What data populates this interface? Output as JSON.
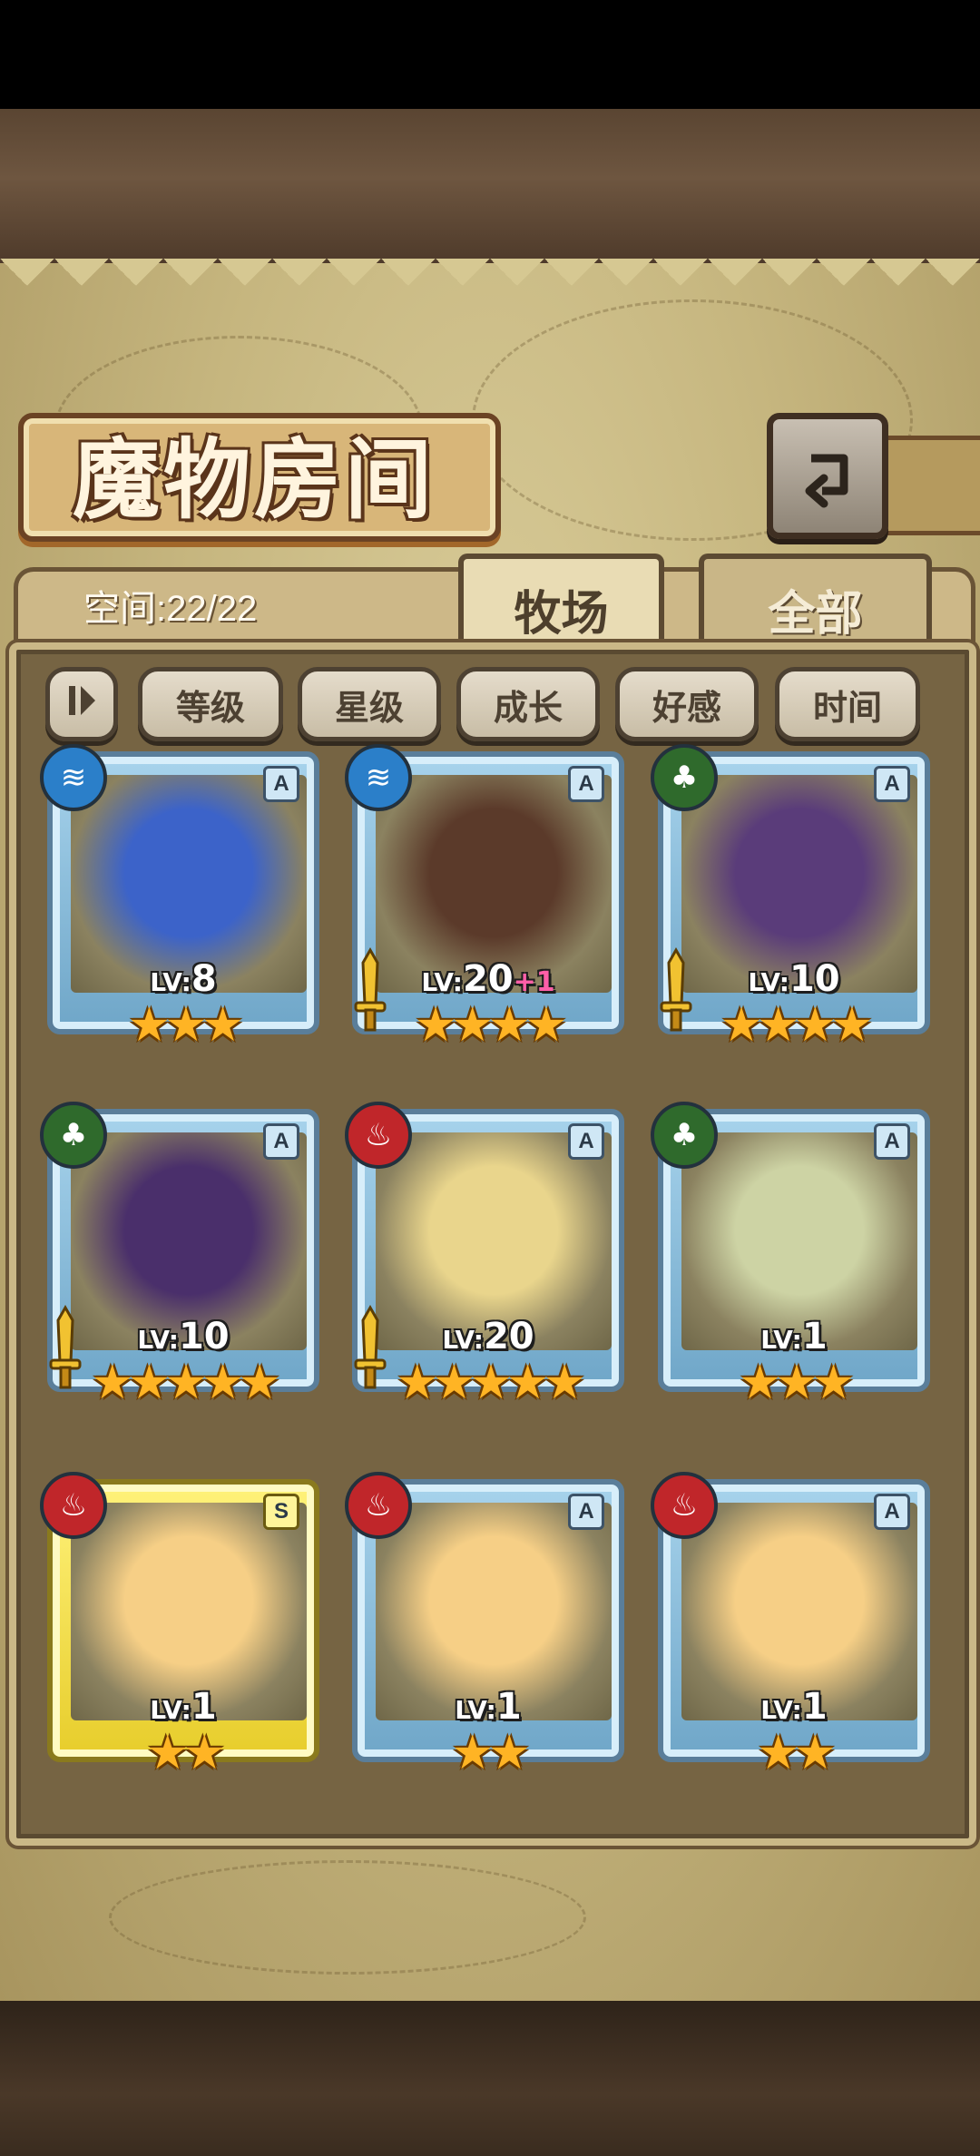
{
  "header": {
    "title": "魔物房间",
    "back_icon": "return-arrow-icon"
  },
  "storage": {
    "space_text": "空间:22/22"
  },
  "tabs": [
    {
      "label": "牧场",
      "active": true
    },
    {
      "label": "全部",
      "active": false
    }
  ],
  "sort": {
    "toggle_icon": "sort-order-icon",
    "buttons": [
      "等级",
      "星级",
      "成长",
      "好感",
      "时间"
    ]
  },
  "monsters": [
    {
      "element": "water",
      "rank": "A",
      "level": "8",
      "stars": "★★★",
      "weapon": false,
      "bonus": "",
      "color": "#3c63c9"
    },
    {
      "element": "water",
      "rank": "A",
      "level": "20",
      "stars": "★★★★",
      "weapon": true,
      "bonus": "+1",
      "color": "#5b3a2a"
    },
    {
      "element": "wood",
      "rank": "A",
      "level": "10",
      "stars": "★★★★",
      "weapon": true,
      "bonus": "",
      "color": "#5a3c7a"
    },
    {
      "element": "wood",
      "rank": "A",
      "level": "10",
      "stars": "★★★★★",
      "weapon": true,
      "bonus": "",
      "color": "#4a2f6b"
    },
    {
      "element": "fire",
      "rank": "A",
      "level": "20",
      "stars": "★★★★★",
      "weapon": true,
      "bonus": "",
      "color": "#e9d58c"
    },
    {
      "element": "wood",
      "rank": "A",
      "level": "1",
      "stars": "★★★",
      "weapon": false,
      "bonus": "",
      "color": "#cdd3a4"
    },
    {
      "element": "fire",
      "rank": "S",
      "level": "1",
      "stars": "★★",
      "weapon": false,
      "bonus": "",
      "color": "#f6cf86"
    },
    {
      "element": "fire",
      "rank": "A",
      "level": "1",
      "stars": "★★",
      "weapon": false,
      "bonus": "",
      "color": "#f6cf86"
    },
    {
      "element": "fire",
      "rank": "A",
      "level": "1",
      "stars": "★★",
      "weapon": false,
      "bonus": "",
      "color": "#f6cf86"
    }
  ],
  "colors": {
    "water": "#2b7fc9",
    "wood": "#2f6a2c",
    "fire": "#c0262a",
    "star": "#ffb424"
  }
}
